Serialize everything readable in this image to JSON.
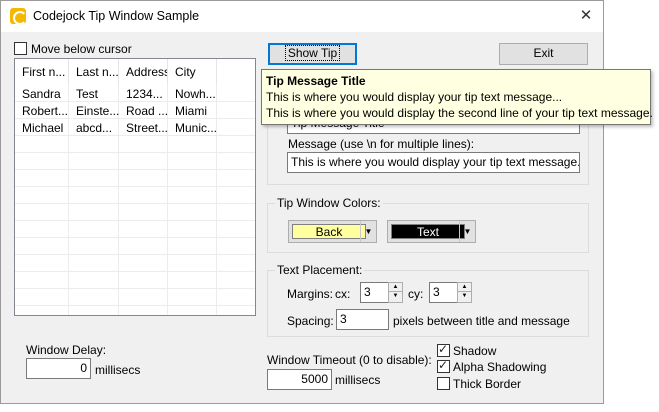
{
  "window": {
    "title": "Codejock Tip Window Sample",
    "close_glyph": "✕"
  },
  "move_below_cursor": {
    "label": "Move below cursor",
    "checked": false
  },
  "listview": {
    "columns": [
      "First n...",
      "Last n...",
      "Address",
      "City"
    ],
    "rows": [
      [
        "Sandra",
        "Test",
        "1234...",
        "Nowh..."
      ],
      [
        "Robert...",
        "Einste...",
        "Road ...",
        "Miami"
      ],
      [
        "Michael",
        "abcd...",
        "Street...",
        "Munic..."
      ]
    ]
  },
  "buttons": {
    "show_tip": "Show Tip",
    "exit": "Exit"
  },
  "message": {
    "label": "Message (use \\n for multiple lines):",
    "value": "This is where you would display your tip text message...This is"
  },
  "title_field": {
    "value": "Tip Message Title"
  },
  "colors": {
    "group_label": "Tip Window Colors:",
    "back_label": "Back",
    "back_color": "#ffffa0",
    "text_label": "Text",
    "text_color": "#000000"
  },
  "placement": {
    "group_label": "Text Placement:",
    "margins_label": "Margins:",
    "cx_label": "cx:",
    "cx_value": "3",
    "cy_label": "cy:",
    "cy_value": "3",
    "spacing_label": "Spacing:",
    "spacing_value": "3",
    "spacing_suffix": "pixels between title and message"
  },
  "delay": {
    "label": "Window Delay:",
    "value": "0",
    "unit": "millisecs"
  },
  "timeout": {
    "label": "Window Timeout (0 to disable):",
    "value": "5000",
    "unit": "millisecs"
  },
  "options": {
    "shadow": {
      "label": "Shadow",
      "checked": true
    },
    "alpha_shadowing": {
      "label": "Alpha Shadowing",
      "checked": true
    },
    "thick_border": {
      "label": "Thick Border",
      "checked": false
    }
  },
  "tooltip": {
    "title": "Tip Message Title",
    "line1": "This is where you would display your tip text message...",
    "line2": "This is where you would display the second line of your tip text message."
  }
}
